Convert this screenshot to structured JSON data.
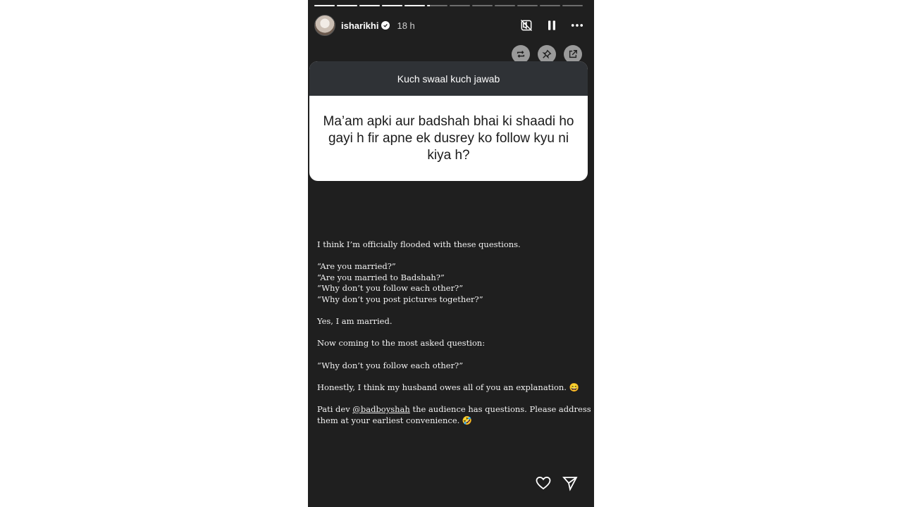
{
  "story": {
    "progress": {
      "total_segments": 12,
      "completed_segments": 5,
      "current_fraction": 0.15
    },
    "user": {
      "username": "isharikhi",
      "verified": true,
      "time_ago": "18 h"
    },
    "header_icons": [
      "mute-icon",
      "pause-icon",
      "more-icon"
    ],
    "action_icons": [
      "repost-icon",
      "pin-icon",
      "share-external-icon"
    ],
    "question_card": {
      "title": "Kuch swaal kuch jawab",
      "question": "Ma’am apki aur badshah bhai ki shaadi ho gayi h fir apne ek dusrey ko follow kyu ni kiya h?"
    },
    "caption": {
      "p1": "I think I’m officially flooded with these questions.",
      "q1": "“Are you married?”",
      "q2": "“Are you married to Badshah?”",
      "q3": "“Why don’t you follow each other?”",
      "q4": "“Why don’t you post pictures together?”",
      "p3": "Yes, I am married.",
      "p4": "Now coming to the most asked question:",
      "p5": "“Why don’t you follow each other?”",
      "p6": "Honestly, I think my husband owes all of you an explanation. 😄",
      "p7_before": "Pati dev ",
      "p7_mention": "@badboyshah",
      "p7_after": " the audience has questions. Please address them at your earliest convenience. 🤣"
    },
    "footer_icons": [
      "heart-icon",
      "send-icon"
    ],
    "colors": {
      "background": "#1f1f1f",
      "card_header": "#2f3236",
      "card_body": "#ffffff",
      "action_button": "#9a9a9a"
    }
  }
}
